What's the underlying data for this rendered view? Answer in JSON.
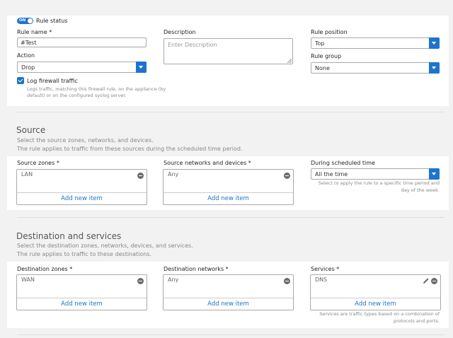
{
  "rule": {
    "status_toggle": "ON",
    "status_label": "Rule status",
    "name_label": "Rule name *",
    "name_value": "#Test",
    "description_label": "Description",
    "description_placeholder": "Enter Description",
    "position_label": "Rule position",
    "position_value": "Top",
    "group_label": "Rule group",
    "group_value": "None",
    "action_label": "Action",
    "action_value": "Drop",
    "log_label": "Log firewall traffic",
    "log_help_line1": "Logs traffic, matching this firewall rule, on the appliance (by",
    "log_help_line2": "default) or on the configured syslog server."
  },
  "source": {
    "title": "Source",
    "desc1": "Select the source zones, networks, and devices.",
    "desc2": "The rule applies to traffic from these sources during the scheduled time period.",
    "zones_label": "Source zones *",
    "zones_item": "LAN",
    "networks_label": "Source networks and devices *",
    "networks_item": "Any",
    "schedule_label": "During scheduled time",
    "schedule_value": "All the time",
    "schedule_help1": "Select to apply the rule to a specific time period and",
    "schedule_help2": "day of the week.",
    "add_label": "Add new item"
  },
  "destination": {
    "title": "Destination and services",
    "desc1": "Select the destination zones, networks, devices, and services.",
    "desc2": "The rule applies to traffic to these destinations.",
    "zones_label": "Destination zones *",
    "zones_item": "WAN",
    "networks_label": "Destination networks *",
    "networks_item": "Any",
    "services_label": "Services *",
    "services_item": "DNS",
    "services_help1": "Services are traffic types based on a combination of",
    "services_help2": "protocols and ports.",
    "add_label": "Add new item"
  }
}
